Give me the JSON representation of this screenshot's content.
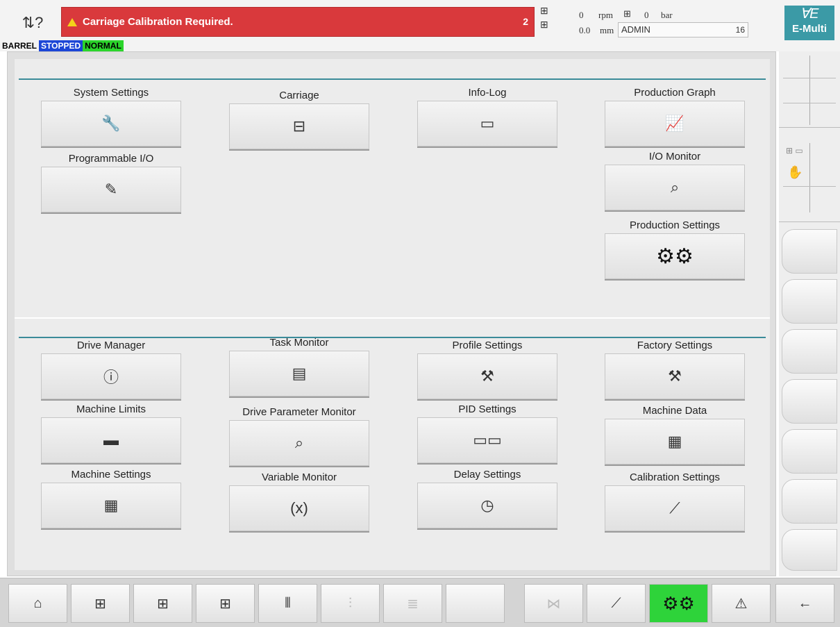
{
  "header": {
    "alarm_text": "Carriage Calibration Required.",
    "alarm_count": "2",
    "readout_rpm_value": "0",
    "readout_rpm_unit": "rpm",
    "readout_bar_value": "0",
    "readout_bar_unit": "bar",
    "readout_mm_value": "0.0",
    "readout_mm_unit": "mm",
    "user": "ADMIN",
    "user_level": "16",
    "logo_text": "E-Multi"
  },
  "status": {
    "barrel": "BARREL",
    "stopped": "STOPPED",
    "normal": "NORMAL"
  },
  "top_items": [
    {
      "label": "System Settings",
      "icon": "wrench-icon",
      "glyph": "🔧"
    },
    {
      "label": "Carriage",
      "icon": "carriage-icon",
      "glyph": "⊟"
    },
    {
      "label": "Info-Log",
      "icon": "monitor-icon",
      "glyph": "▭"
    },
    {
      "label": "Production Graph",
      "icon": "graph-icon",
      "glyph": "📈"
    },
    {
      "label": "Programmable I/O",
      "icon": "io-edit-icon",
      "glyph": "✎"
    },
    {
      "label": "I/O Monitor",
      "icon": "io-monitor-icon",
      "glyph": "⌕"
    },
    {
      "label": "Production Settings",
      "icon": "gears-icon",
      "glyph": "⚙⚙"
    }
  ],
  "bottom_items": [
    {
      "label": "Drive Manager",
      "icon": "drive-info-icon",
      "glyph": "ⓘ"
    },
    {
      "label": "Task Monitor",
      "icon": "task-monitor-icon",
      "glyph": "▤"
    },
    {
      "label": "Profile Settings",
      "icon": "profile-settings-icon",
      "glyph": "⚒"
    },
    {
      "label": "Factory Settings",
      "icon": "factory-settings-icon",
      "glyph": "⚒"
    },
    {
      "label": "Machine Limits",
      "icon": "machine-limits-icon",
      "glyph": "▬"
    },
    {
      "label": "Drive Parameter Monitor",
      "icon": "drive-parameter-icon",
      "glyph": "⌕"
    },
    {
      "label": "PID Settings",
      "icon": "pid-icon",
      "glyph": "▭▭"
    },
    {
      "label": "Machine Data",
      "icon": "machine-data-icon",
      "glyph": "▦"
    },
    {
      "label": "Machine Settings",
      "icon": "machine-settings-icon",
      "glyph": "▦"
    },
    {
      "label": "Variable Monitor",
      "icon": "variable-monitor-icon",
      "glyph": "(x)"
    },
    {
      "label": "Delay Settings",
      "icon": "clock-icon",
      "glyph": "◷"
    },
    {
      "label": "Calibration Settings",
      "icon": "calibration-graph-icon",
      "glyph": "⟋"
    }
  ],
  "nav": [
    {
      "icon": "home-icon",
      "glyph": "⌂"
    },
    {
      "icon": "screw-icon",
      "glyph": "⊞"
    },
    {
      "icon": "heater-icon",
      "glyph": "⊞"
    },
    {
      "icon": "screw-return-icon",
      "glyph": "⊞"
    },
    {
      "icon": "temperature-profile-icon",
      "glyph": "⫴"
    },
    {
      "icon": "dosing-icon",
      "glyph": "⫶"
    },
    {
      "icon": "list-icon",
      "glyph": "≣"
    },
    {
      "icon": "blank-icon",
      "glyph": ""
    },
    {
      "icon": "valve-icon",
      "glyph": "⋈"
    },
    {
      "icon": "graph-icon",
      "glyph": "⟋"
    },
    {
      "icon": "settings-gears-icon",
      "glyph": "⚙⚙"
    },
    {
      "icon": "alarm-triangle-icon",
      "glyph": "⚠"
    },
    {
      "icon": "back-arrow-icon",
      "glyph": "←"
    }
  ]
}
